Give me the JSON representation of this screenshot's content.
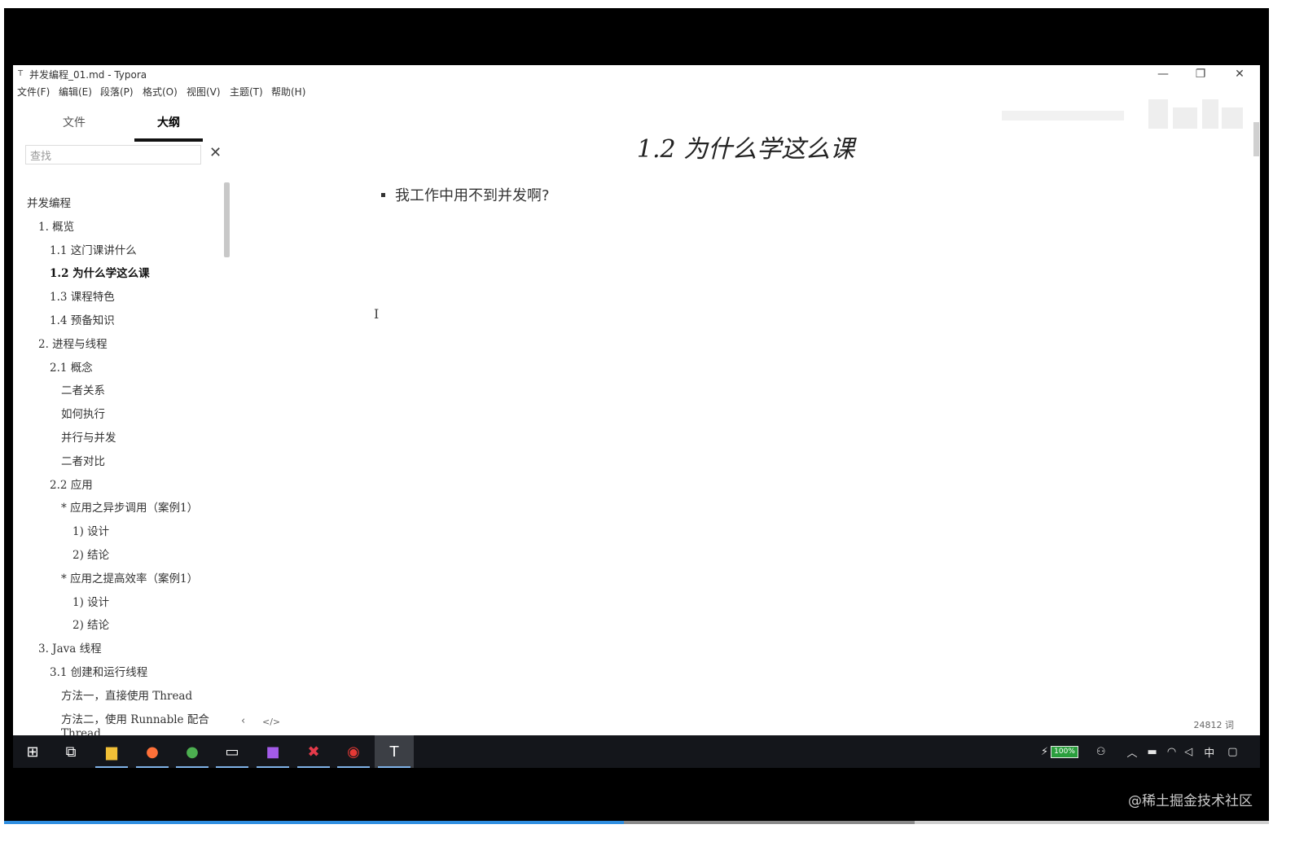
{
  "window": {
    "title": "并发编程_01.md - Typora",
    "app_icon": "T",
    "controls": {
      "minimize": "—",
      "restore": "❐",
      "close": "✕"
    }
  },
  "menu": [
    "文件(F)",
    "编辑(E)",
    "段落(P)",
    "格式(O)",
    "视图(V)",
    "主题(T)",
    "帮助(H)"
  ],
  "sidebar": {
    "tabs": [
      {
        "label": "文件",
        "active": false
      },
      {
        "label": "大纲",
        "active": true
      }
    ],
    "search_placeholder": "查找",
    "search_clear": "✕",
    "outline": [
      {
        "text": "并发编程",
        "level": 0
      },
      {
        "text": "1. 概览",
        "level": 1
      },
      {
        "text": "1.1 这门课讲什么",
        "level": 2
      },
      {
        "text": "1.2 为什么学这么课",
        "level": 2,
        "active": true
      },
      {
        "text": "1.3 课程特色",
        "level": 2
      },
      {
        "text": "1.4 预备知识",
        "level": 2
      },
      {
        "text": "2. 进程与线程",
        "level": 1
      },
      {
        "text": "2.1 概念",
        "level": 2
      },
      {
        "text": "二者关系",
        "level": 3
      },
      {
        "text": "如何执行",
        "level": 3
      },
      {
        "text": "并行与并发",
        "level": 3
      },
      {
        "text": "二者对比",
        "level": 3
      },
      {
        "text": "2.2 应用",
        "level": 2
      },
      {
        "text": "* 应用之异步调用（案例1）",
        "level": 3
      },
      {
        "text": "1) 设计",
        "level": 4
      },
      {
        "text": "2) 结论",
        "level": 4
      },
      {
        "text": "* 应用之提高效率（案例1）",
        "level": 3
      },
      {
        "text": "1) 设计",
        "level": 4
      },
      {
        "text": "2) 结论",
        "level": 4
      },
      {
        "text": "3. Java 线程",
        "level": 1
      },
      {
        "text": "3.1 创建和运行线程",
        "level": 2
      },
      {
        "text": "方法一，直接使用 Thread",
        "level": 3
      },
      {
        "text": "方法二，使用 Runnable 配合",
        "level": 3
      },
      {
        "text": "Thread",
        "level": 3
      }
    ]
  },
  "editor": {
    "heading": "1.2 为什么学这么课",
    "bullets": [
      "我工作中用不到并发啊?"
    ],
    "cursor_glyph": "I",
    "footer_prev": "‹",
    "footer_code": "</>",
    "word_count": "24812 词"
  },
  "taskbar": {
    "apps": [
      {
        "name": "windows-start",
        "glyph": "⊞",
        "color": "#ffffff"
      },
      {
        "name": "task-view",
        "glyph": "⧉",
        "color": "#ffffff"
      },
      {
        "name": "file-explorer",
        "glyph": "▆",
        "color": "#f2c037"
      },
      {
        "name": "firefox",
        "glyph": "●",
        "color": "#ff7139"
      },
      {
        "name": "chrome",
        "glyph": "●",
        "color": "#4caf50"
      },
      {
        "name": "terminal",
        "glyph": "▭",
        "color": "#ffffff"
      },
      {
        "name": "intellij",
        "glyph": "■",
        "color": "#a35be8"
      },
      {
        "name": "xmind",
        "glyph": "✖",
        "color": "#e53a4a"
      },
      {
        "name": "recorder",
        "glyph": "◉",
        "color": "#e53935"
      },
      {
        "name": "typora",
        "glyph": "T",
        "color": "#ffffff"
      }
    ],
    "battery": "100%",
    "ime": "中"
  },
  "video": {
    "progress": 0.49,
    "buffered_to": 0.72,
    "watermark": "@稀土掘金技术社区"
  },
  "colors": {
    "taskbar_bg": "#14161b",
    "progress": "#2f8ee0",
    "accent_underline": "#7fb3e8"
  }
}
